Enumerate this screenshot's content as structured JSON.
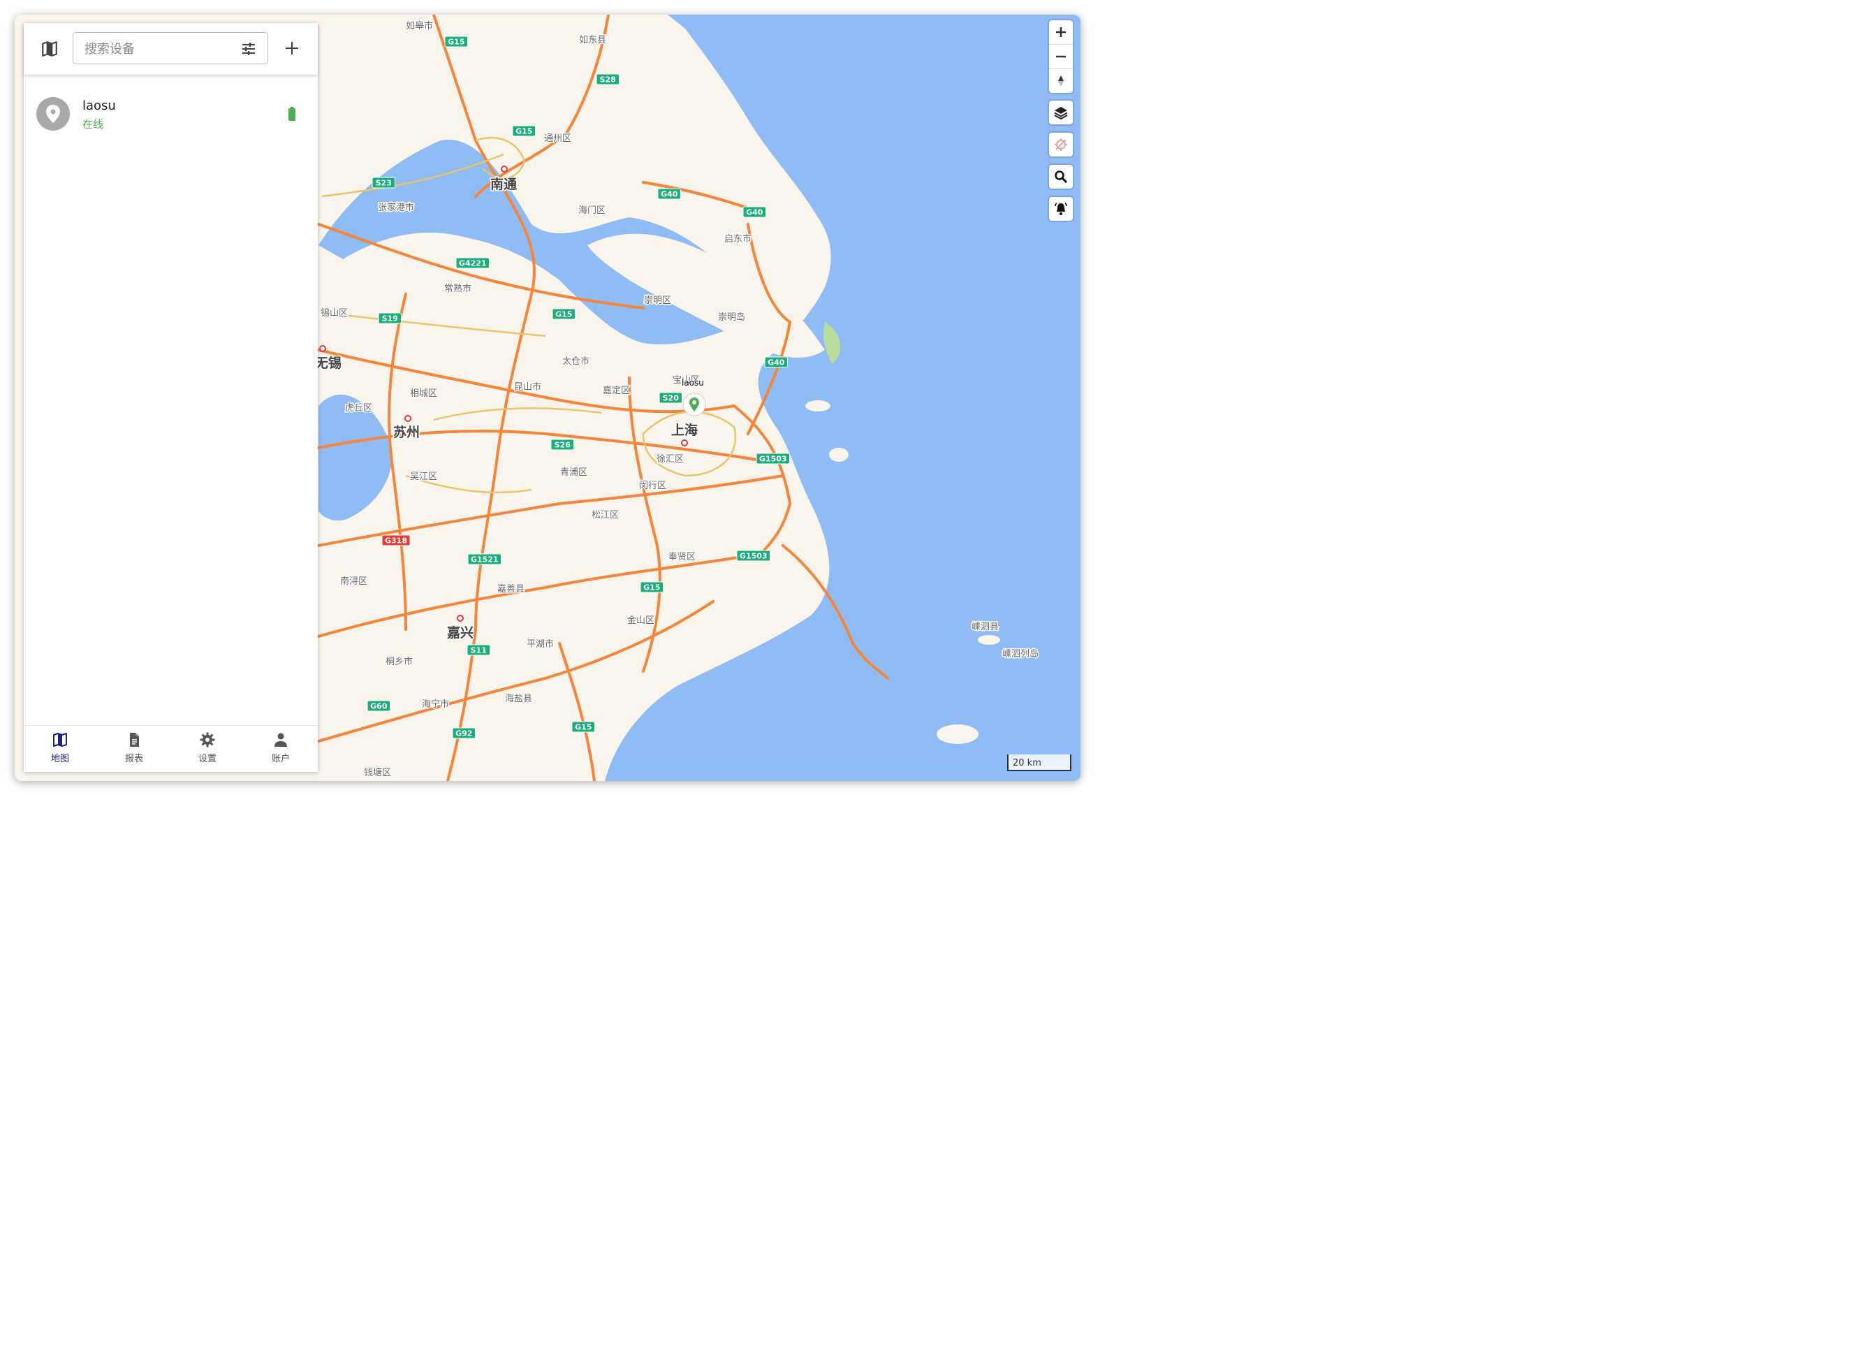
{
  "toolbar": {
    "search_placeholder": "搜索设备"
  },
  "devices": [
    {
      "name": "laosu",
      "status": "在线",
      "status_color": "#4caf50",
      "battery_color": "#4caf50"
    }
  ],
  "bottom_nav": [
    {
      "label": "地图",
      "icon": "map-icon",
      "active": true
    },
    {
      "label": "报表",
      "icon": "report-icon",
      "active": false
    },
    {
      "label": "设置",
      "icon": "gear-icon",
      "active": false
    },
    {
      "label": "账户",
      "icon": "person-icon",
      "active": false
    }
  ],
  "map": {
    "marker": {
      "label": "laosu",
      "color": "#4caf50"
    },
    "scale": "20 km",
    "colors": {
      "land": "#f9f4ec",
      "water": "#8fbcf5",
      "highway": "#f5853a",
      "road": "#e9c46a",
      "expressway_shield": "#1aae7a"
    },
    "places": [
      {
        "name": "如皋市",
        "type": "minor"
      },
      {
        "name": "如东县",
        "type": "minor"
      },
      {
        "name": "通州区",
        "type": "minor"
      },
      {
        "name": "南通",
        "type": "city"
      },
      {
        "name": "海门区",
        "type": "minor"
      },
      {
        "name": "启东市",
        "type": "minor"
      },
      {
        "name": "张家港市",
        "type": "minor"
      },
      {
        "name": "常熟市",
        "type": "minor"
      },
      {
        "name": "崇明区",
        "type": "minor"
      },
      {
        "name": "崇明岛",
        "type": "minor"
      },
      {
        "name": "锡山区",
        "type": "minor"
      },
      {
        "name": "无锡",
        "type": "city"
      },
      {
        "name": "太仓市",
        "type": "minor"
      },
      {
        "name": "宝山区",
        "type": "minor"
      },
      {
        "name": "相城区",
        "type": "minor"
      },
      {
        "name": "昆山市",
        "type": "minor"
      },
      {
        "name": "嘉定区",
        "type": "minor"
      },
      {
        "name": "虎丘区",
        "type": "minor"
      },
      {
        "name": "苏州",
        "type": "city"
      },
      {
        "name": "上海",
        "type": "city"
      },
      {
        "name": "徐汇区",
        "type": "minor"
      },
      {
        "name": "吴江区",
        "type": "minor"
      },
      {
        "name": "青浦区",
        "type": "minor"
      },
      {
        "name": "闵行区",
        "type": "minor"
      },
      {
        "name": "松江区",
        "type": "minor"
      },
      {
        "name": "奉贤区",
        "type": "minor"
      },
      {
        "name": "南浔区",
        "type": "minor"
      },
      {
        "name": "嘉善县",
        "type": "minor"
      },
      {
        "name": "金山区",
        "type": "minor"
      },
      {
        "name": "嘉兴",
        "type": "city"
      },
      {
        "name": "平湖市",
        "type": "minor"
      },
      {
        "name": "桐乡市",
        "type": "minor"
      },
      {
        "name": "海宁市",
        "type": "minor"
      },
      {
        "name": "海盐县",
        "type": "minor"
      },
      {
        "name": "钱塘区",
        "type": "minor"
      },
      {
        "name": "嵊泗县",
        "type": "minor"
      },
      {
        "name": "嵊泗列岛",
        "type": "minor"
      }
    ],
    "shields": [
      {
        "code": "G15",
        "kind": "expressway"
      },
      {
        "code": "S28",
        "kind": "expressway"
      },
      {
        "code": "G15",
        "kind": "expressway"
      },
      {
        "code": "S23",
        "kind": "expressway"
      },
      {
        "code": "G40",
        "kind": "expressway"
      },
      {
        "code": "G40",
        "kind": "expressway"
      },
      {
        "code": "G4221",
        "kind": "expressway"
      },
      {
        "code": "S19",
        "kind": "expressway"
      },
      {
        "code": "G15",
        "kind": "expressway"
      },
      {
        "code": "G40",
        "kind": "expressway"
      },
      {
        "code": "S20",
        "kind": "expressway"
      },
      {
        "code": "S26",
        "kind": "expressway"
      },
      {
        "code": "G1503",
        "kind": "expressway"
      },
      {
        "code": "G318",
        "kind": "national"
      },
      {
        "code": "G1521",
        "kind": "expressway"
      },
      {
        "code": "G1503",
        "kind": "expressway"
      },
      {
        "code": "G15",
        "kind": "expressway"
      },
      {
        "code": "S11",
        "kind": "expressway"
      },
      {
        "code": "G60",
        "kind": "expressway"
      },
      {
        "code": "G92",
        "kind": "expressway"
      },
      {
        "code": "G15",
        "kind": "expressway"
      }
    ]
  }
}
